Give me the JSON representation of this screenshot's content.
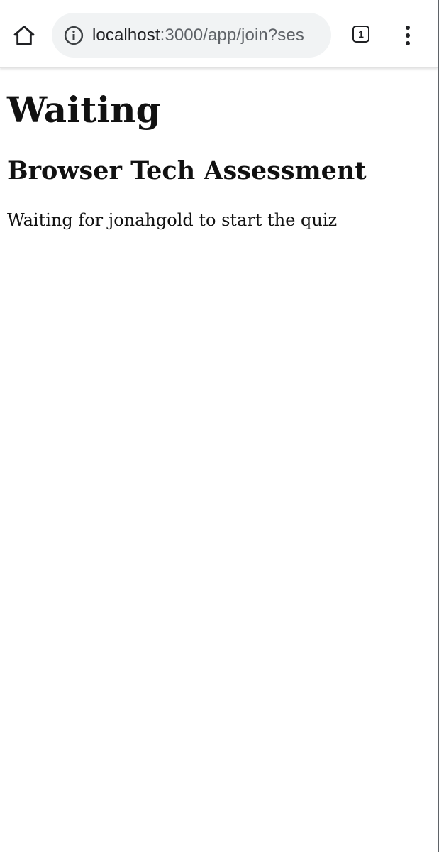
{
  "browser": {
    "url_host": "localhost",
    "url_path": ":3000/app/join?ses",
    "tab_count": "1",
    "icons": {
      "home": "home-icon",
      "site_info": "info-icon",
      "tabs": "tab-switcher-icon",
      "menu": "more-vert-icon"
    }
  },
  "page": {
    "title": "Waiting",
    "subtitle": "Browser Tech Assessment",
    "message": "Waiting for jonahgold to start the quiz"
  }
}
